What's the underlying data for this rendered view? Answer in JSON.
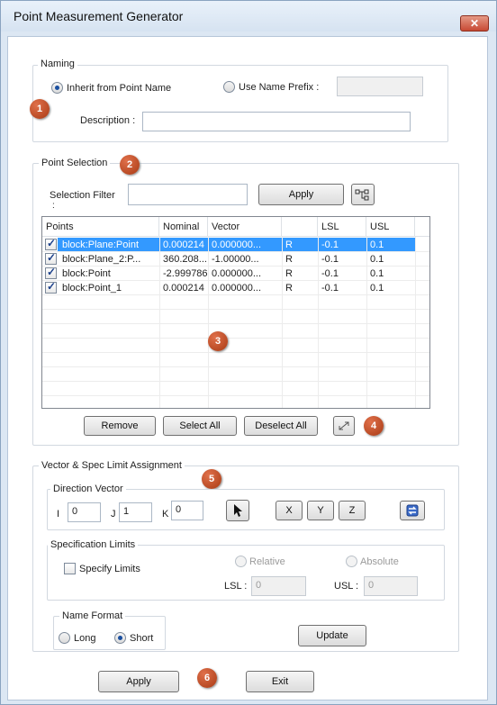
{
  "window": {
    "title": "Point Measurement Generator",
    "close_glyph": "✕"
  },
  "naming": {
    "group_label": "Naming",
    "inherit_label": "Inherit from Point Name",
    "inherit_selected": true,
    "prefix_label": "Use Name Prefix :",
    "prefix_selected": false,
    "prefix_value": "",
    "description_label": "Description :",
    "description_value": ""
  },
  "point_selection": {
    "group_label": "Point Selection",
    "filter_label": "Selection Filter",
    "filter_colon": ":",
    "filter_value": "",
    "apply_label": "Apply",
    "filter_icon": "filter-select-icon",
    "columns": [
      "Points",
      "Nominal",
      "Vector",
      "",
      "LSL",
      "USL"
    ],
    "rows": [
      {
        "checked": true,
        "selected": true,
        "cells": [
          "block:Plane:Point",
          "0.000214",
          "0.000000...",
          "R",
          "-0.1",
          "0.1"
        ]
      },
      {
        "checked": true,
        "selected": false,
        "cells": [
          "block:Plane_2:P...",
          "360.208...",
          "-1.00000...",
          "R",
          "-0.1",
          "0.1"
        ]
      },
      {
        "checked": true,
        "selected": false,
        "cells": [
          "block:Point",
          "-2.999786",
          "0.000000...",
          "R",
          "-0.1",
          "0.1"
        ]
      },
      {
        "checked": true,
        "selected": false,
        "cells": [
          "block:Point_1",
          "0.000214",
          "0.000000...",
          "R",
          "-0.1",
          "0.1"
        ]
      }
    ],
    "remove_label": "Remove",
    "select_all_label": "Select All",
    "deselect_all_label": "Deselect All",
    "expand_icon": "expand-icon"
  },
  "assignment": {
    "group_label": "Vector & Spec Limit Assignment",
    "direction": {
      "label": "Direction Vector",
      "i_label": "I",
      "i_value": "0",
      "j_label": "J",
      "j_value": "1",
      "k_label": "K",
      "k_value": "0",
      "pick_icon": "cursor-pick-icon",
      "x_label": "X",
      "y_label": "Y",
      "z_label": "Z",
      "flip_icon": "flip-vector-icon"
    },
    "spec": {
      "label": "Specification Limits",
      "specify_label": "Specify Limits",
      "specify_checked": false,
      "relative_label": "Relative",
      "absolute_label": "Absolute",
      "lsl_label": "LSL :",
      "lsl_value": "0",
      "usl_label": "USL :",
      "usl_value": "0"
    },
    "name_format": {
      "label": "Name Format",
      "long_label": "Long",
      "long_selected": false,
      "short_label": "Short",
      "short_selected": true
    },
    "update_label": "Update"
  },
  "footer": {
    "apply_label": "Apply",
    "exit_label": "Exit"
  },
  "badges": [
    "1",
    "2",
    "3",
    "4",
    "5",
    "6"
  ],
  "colors": {
    "selection": "#3399ff",
    "badge": "#c0481c",
    "frame": "#dce7f3"
  }
}
